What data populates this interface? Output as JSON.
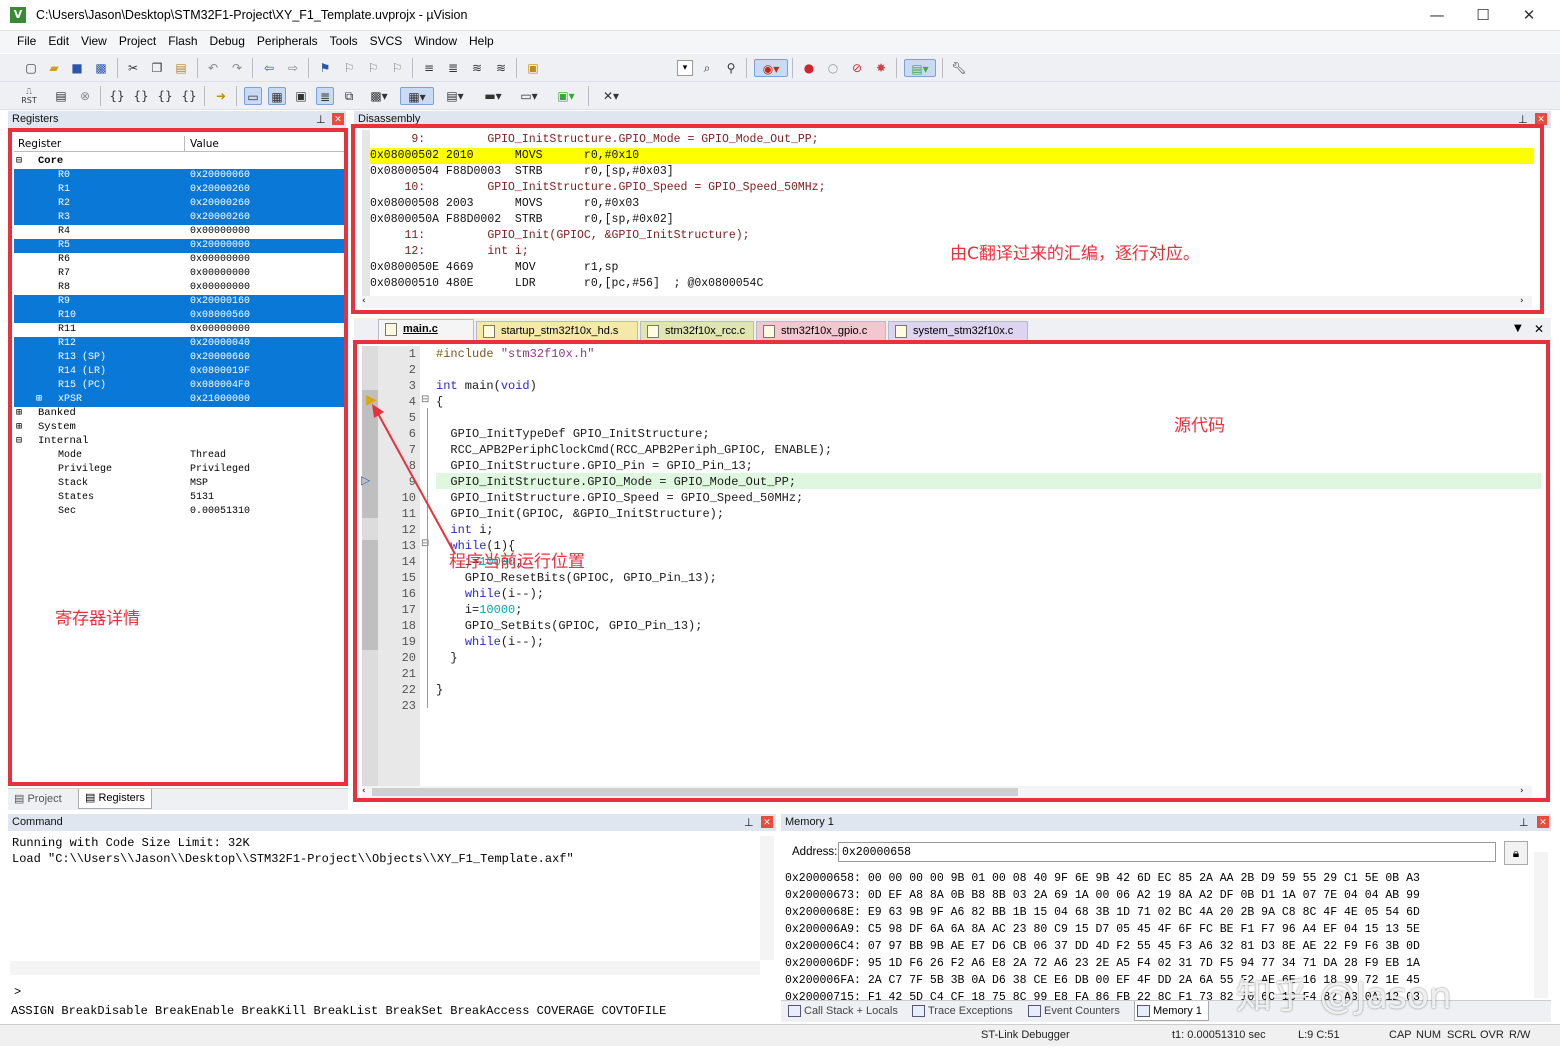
{
  "window": {
    "title": "C:\\Users\\Jason\\Desktop\\STM32F1-Project\\XY_F1_Template.uvprojx - µVision",
    "app_icon": "V",
    "minimize": "—",
    "maximize": "☐",
    "close": "✕"
  },
  "menu": [
    "File",
    "Edit",
    "View",
    "Project",
    "Flash",
    "Debug",
    "Peripherals",
    "Tools",
    "SVCS",
    "Window",
    "Help"
  ],
  "registers": {
    "title": "Registers",
    "col_register": "Register",
    "col_value": "Value",
    "core_label": "Core",
    "core": [
      {
        "name": "R0",
        "value": "0x20000060",
        "selected": true
      },
      {
        "name": "R1",
        "value": "0x20000260",
        "selected": true
      },
      {
        "name": "R2",
        "value": "0x20000260",
        "selected": true
      },
      {
        "name": "R3",
        "value": "0x20000260",
        "selected": true
      },
      {
        "name": "R4",
        "value": "0x00000000",
        "selected": false
      },
      {
        "name": "R5",
        "value": "0x20000000",
        "selected": true
      },
      {
        "name": "R6",
        "value": "0x00000000",
        "selected": false
      },
      {
        "name": "R7",
        "value": "0x00000000",
        "selected": false
      },
      {
        "name": "R8",
        "value": "0x00000000",
        "selected": false
      },
      {
        "name": "R9",
        "value": "0x20000160",
        "selected": true
      },
      {
        "name": "R10",
        "value": "0x08000560",
        "selected": true
      },
      {
        "name": "R11",
        "value": "0x00000000",
        "selected": false
      },
      {
        "name": "R12",
        "value": "0x20000040",
        "selected": true
      },
      {
        "name": "R13 (SP)",
        "value": "0x20000660",
        "selected": true
      },
      {
        "name": "R14 (LR)",
        "value": "0x0800019F",
        "selected": true
      },
      {
        "name": "R15 (PC)",
        "value": "0x080004F0",
        "selected": true
      },
      {
        "name": "xPSR",
        "value": "0x21000000",
        "selected": true
      }
    ],
    "groups": [
      "Banked",
      "System",
      "Internal"
    ],
    "internal": [
      {
        "name": "Mode",
        "value": "Thread"
      },
      {
        "name": "Privilege",
        "value": "Privileged"
      },
      {
        "name": "Stack",
        "value": "MSP"
      },
      {
        "name": "States",
        "value": "5131"
      },
      {
        "name": "Sec",
        "value": "0.00051310"
      }
    ],
    "annotation": "寄存器详情",
    "tab_project": "Project",
    "tab_registers": "Registers"
  },
  "disassembly": {
    "title": "Disassembly",
    "lines": [
      "      9:         GPIO_InitStructure.GPIO_Mode = GPIO_Mode_Out_PP;",
      "0x08000502 2010      MOVS      r0,#0x10",
      "0x08000504 F88D0003  STRB      r0,[sp,#0x03]",
      "     10:         GPIO_InitStructure.GPIO_Speed = GPIO_Speed_50MHz;",
      "0x08000508 2003      MOVS      r0,#0x03",
      "0x0800050A F88D0002  STRB      r0,[sp,#0x02]",
      "     11:         GPIO_Init(GPIOC, &GPIO_InitStructure);",
      "     12:         int i;",
      "0x0800050E 4669      MOV       r1,sp",
      "0x08000510 480E      LDR       r0,[pc,#56]  ; @0x0800054C"
    ],
    "highlight_index": 1,
    "annotation": "由C翻译过来的汇编，逐行对应。"
  },
  "tabs": [
    "main.c",
    "startup_stm32f10x_hd.s",
    "stm32f10x_rcc.c",
    "stm32f10x_gpio.c",
    "system_stm32f10x.c"
  ],
  "tab_colors": [
    "#f5f5f5",
    "#f4e9a8",
    "#dfe6b0",
    "#f4c6cf",
    "#dcd4f0"
  ],
  "editor": {
    "lines": [
      "#include \"stm32f10x.h\"",
      "",
      "int main(void)",
      "{",
      "",
      "  GPIO_InitTypeDef GPIO_InitStructure;",
      "  RCC_APB2PeriphClockCmd(RCC_APB2Periph_GPIOC, ENABLE);",
      "  GPIO_InitStructure.GPIO_Pin = GPIO_Pin_13;",
      "  GPIO_InitStructure.GPIO_Mode = GPIO_Mode_Out_PP;",
      "  GPIO_InitStructure.GPIO_Speed = GPIO_Speed_50MHz;",
      "  GPIO_Init(GPIOC, &GPIO_InitStructure);",
      "  int i;",
      "  while(1){",
      "    i=10000;",
      "    GPIO_ResetBits(GPIOC, GPIO_Pin_13);",
      "    while(i--);",
      "    i=10000;",
      "    GPIO_SetBits(GPIOC, GPIO_Pin_13);",
      "    while(i--);",
      "  }",
      "",
      "}",
      ""
    ],
    "current_line": 9,
    "annotation_source": "源代码",
    "annotation_position": "程序当前运行位置"
  },
  "command": {
    "title": "Command",
    "output": [
      "Running with Code Size Limit: 32K",
      "Load \"C:\\\\Users\\\\Jason\\\\Desktop\\\\STM32F1-Project\\\\Objects\\\\XY_F1_Template.axf\""
    ],
    "prompt": ">",
    "hints": "ASSIGN BreakDisable BreakEnable BreakKill BreakList BreakSet BreakAccess COVERAGE COVTOFILE"
  },
  "memory": {
    "title": "Memory 1",
    "address_label": "Address:",
    "address_value": "0x20000658",
    "lines": [
      "0x20000658: 00 00 00 00 9B 01 00 08 40 9F 6E 9B 42 6D EC 85 2A AA 2B D9 59 55 29 C1 5E 0B A3",
      "0x20000673: 0D EF A8 8A 0B B8 8B 03 2A 69 1A 00 06 A2 19 8A A2 DF 0B D1 1A 07 7E 04 04 AB 99",
      "0x2000068E: E9 63 9B 9F A6 82 BB 1B 15 04 68 3B 1D 71 02 BC 4A 20 2B 9A C8 8C 4F 4E 05 54 6D",
      "0x200006A9: C5 98 DF 6A 6A 8A AC 23 80 C9 15 D7 05 45 4F 6F FC BE F1 F7 96 A4 EF 04 15 13 5E",
      "0x200006C4: 07 97 BB 9B AE E7 D6 CB 06 37 DD 4D F2 55 45 F3 A6 32 81 D3 8E AE 22 F9 F6 3B 0D",
      "0x200006DF: 95 1D F6 26 F2 A6 E8 2A 72 A6 23 2E A5 F4 02 31 7D F5 94 77 34 71 DA 28 F9 EB 1A",
      "0x200006FA: 2A C7 7F 5B 3B 0A D6 38 CE E6 DB 00 EF 4F DD 2A 6A 55 F2 AE 6E 16 18 99 72 1E 45",
      "0x20000715: F1 42 5D C4 CF 18 75 8C 99 E8 FA 86 FB 22 8C F1 73 82 10 6C 1C F4 82 A3 0A 12 03"
    ]
  },
  "bottom_tabs": [
    "Call Stack + Locals",
    "Trace Exceptions",
    "Event Counters",
    "Memory 1"
  ],
  "status": {
    "debugger": "ST-Link Debugger",
    "time": "t1: 0.00051310 sec",
    "pos": "L:9 C:51",
    "caps": "CAP",
    "num": "NUM",
    "scrl": "SCRL",
    "ovr": "OVR",
    "rw": "R/W"
  },
  "watermark": "知乎 @Jason"
}
